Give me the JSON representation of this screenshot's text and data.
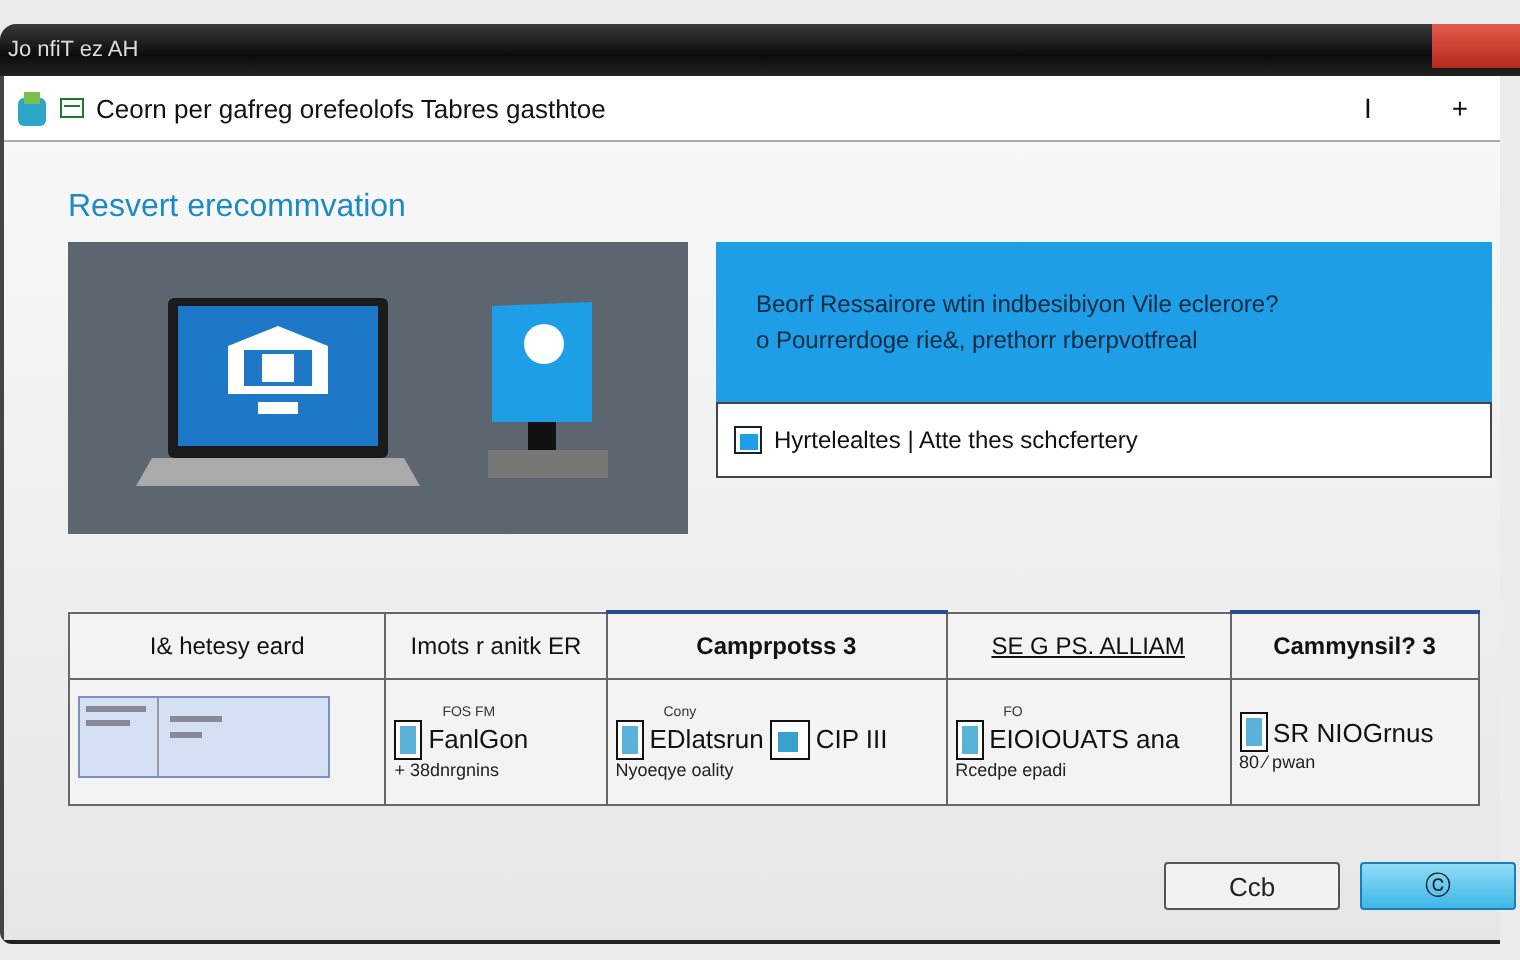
{
  "frame": {
    "title": "Jo nfiT ez AH"
  },
  "window": {
    "title": "Ceorn per gafreg orefeolofs Tabres gasthtoe",
    "controls": [
      "I",
      "+"
    ]
  },
  "heading": "Resvert erecommvation",
  "banner": {
    "lines": [
      "Beorf Ressairore wtin indbesibiyon Vile eclerore?",
      "o Pourrerdoge rie&, prethorr rberpvotfreal"
    ]
  },
  "note": "Hyrtelealtes | Atte thes schcfertery",
  "table": {
    "columns": [
      "I& hetesy eard",
      "Imots r anitk ER",
      "Camprpotss 3",
      "SE G PS. ALLIAM",
      "Cammynsil? 3"
    ],
    "cells": [
      {
        "kind": "preview"
      },
      {
        "kind": "item",
        "caption": "FOS FM",
        "text": "FanlGon",
        "sub": "+ 38dnrgnins"
      },
      {
        "kind": "item",
        "caption": "Cony",
        "text": "EDlatsrun",
        "extra": "CIP III",
        "sub": "Nyoeqye oality"
      },
      {
        "kind": "item",
        "caption": "FO",
        "text": "EIOIOUATS ana",
        "sub": "Rcedpe epadi"
      },
      {
        "kind": "item",
        "text": "SR NIOGrnus",
        "sub": "80 ⁄ pwan"
      }
    ]
  },
  "buttons": [
    {
      "label": "Ccb",
      "default": false
    },
    {
      "label": "ⓒ",
      "default": true
    }
  ]
}
